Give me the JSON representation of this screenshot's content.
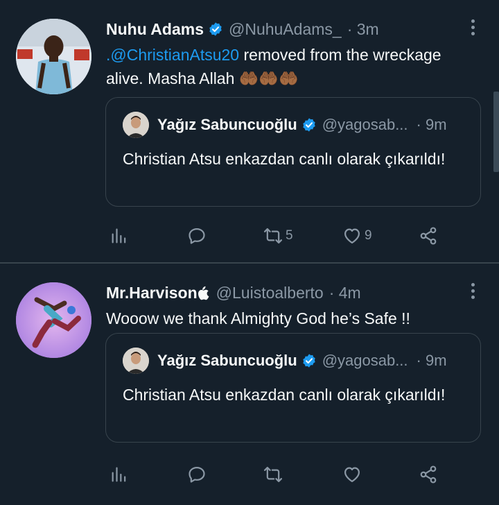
{
  "colors": {
    "background": "#15202b",
    "accent": "#1d9bf0",
    "secondary_text": "#8b98a5",
    "border": "#38444d"
  },
  "tweets": [
    {
      "author": {
        "name": "Nuhu Adams",
        "handle": "@NuhuAdams_"
      },
      "time": "· 3m",
      "text_mention": ".@ChristianAtsu20",
      "text_rest": " removed from the wreckage alive. Masha Allah 🤲🏾🤲🏾🤲🏾",
      "quote": {
        "author": {
          "name": "Yağız Sabuncuoğlu",
          "handle": "@yagosab..."
        },
        "time": "· 9m",
        "text": "Christian Atsu enkazdan canlı olarak çıkarıldı!"
      },
      "actions": {
        "views_icon": "analytics-icon",
        "reply_icon": "reply-icon",
        "retweets": "5",
        "likes": "9",
        "share_icon": "share-icon"
      }
    },
    {
      "author": {
        "name": "Mr.Harvison",
        "handle": "@Luistoalberto"
      },
      "time": "· 4m",
      "text": "Wooow we thank Almighty God he’s Safe !!",
      "quote": {
        "author": {
          "name": "Yağız Sabuncuoğlu",
          "handle": "@yagosab..."
        },
        "time": "· 9m",
        "text": "Christian Atsu enkazdan canlı olarak çıkarıldı!"
      },
      "actions": {
        "views_icon": "analytics-icon",
        "reply_icon": "reply-icon",
        "retweets": "",
        "likes": "",
        "share_icon": "share-icon"
      }
    }
  ]
}
